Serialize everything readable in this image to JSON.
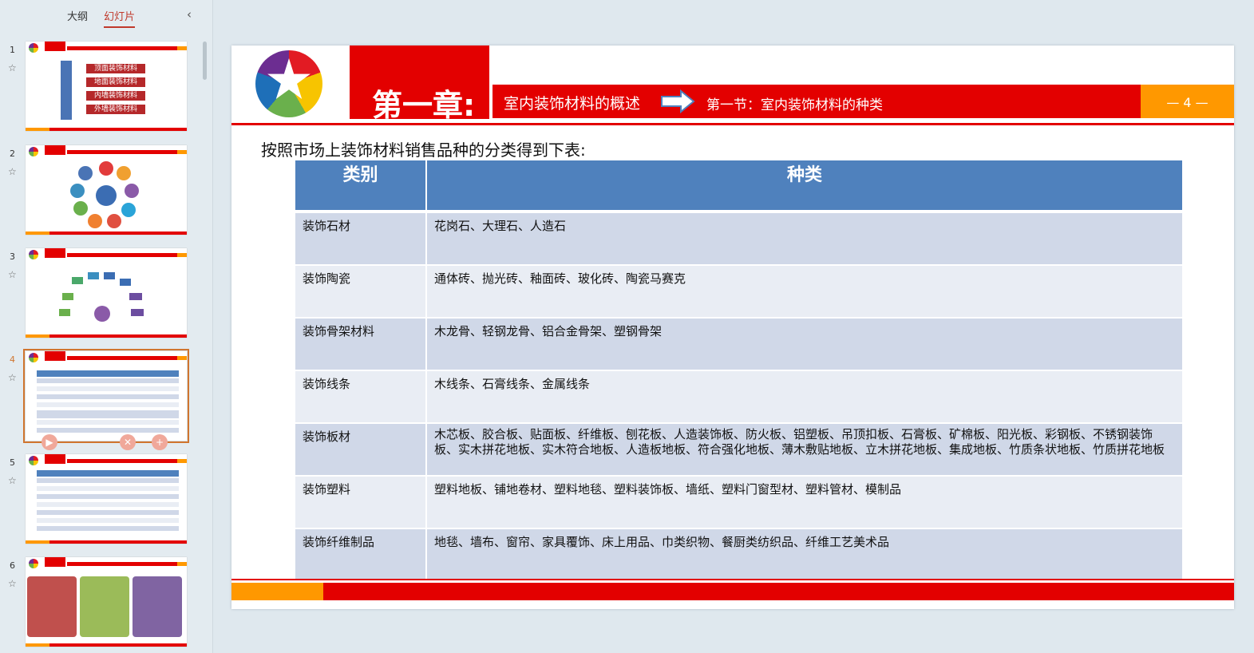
{
  "panel": {
    "tabs": [
      "大纲",
      "幻灯片"
    ],
    "active_tab": "幻灯片",
    "thumbnails": [
      {
        "number": "1",
        "boxes": [
          "顶面装饰材料",
          "地面装饰材料",
          "内墙装饰材料",
          "外墙装饰材料"
        ]
      },
      {
        "number": "2"
      },
      {
        "number": "3"
      },
      {
        "number": "4",
        "active": true
      },
      {
        "number": "5"
      },
      {
        "number": "6"
      }
    ]
  },
  "slide": {
    "chapter": "第一章:",
    "header_text": "室内装饰材料的概述",
    "section_text": "第一节：室内装饰材料的种类",
    "page_number": "— 4 —",
    "intro": "按照市场上装饰材料销售品种的分类得到下表:",
    "table": {
      "headers": [
        "类别",
        "种类"
      ],
      "rows": [
        {
          "category": "装饰石材",
          "types": "花岗石、大理石、人造石"
        },
        {
          "category": "装饰陶瓷",
          "types": "通体砖、抛光砖、釉面砖、玻化砖、陶瓷马赛克"
        },
        {
          "category": "装饰骨架材料",
          "types": "木龙骨、轻钢龙骨、铝合金骨架、塑钢骨架"
        },
        {
          "category": "装饰线条",
          "types": "木线条、石膏线条、金属线条"
        },
        {
          "category": "装饰板材",
          "types": "木芯板、胶合板、贴面板、纤维板、刨花板、人造装饰板、防火板、铝塑板、吊顶扣板、石膏板、矿棉板、阳光板、彩钢板、不锈钢装饰板、实木拼花地板、实木符合地板、人造板地板、符合强化地板、薄木敷贴地板、立木拼花地板、集成地板、竹质条状地板、竹质拼花地板"
        },
        {
          "category": "装饰塑料",
          "types": "塑料地板、铺地卷材、塑料地毯、塑料装饰板、墙纸、塑料门窗型材、塑料管材、模制品"
        },
        {
          "category": "装饰纤维制品",
          "types": "地毯、墙布、窗帘、家具覆饰、床上用品、巾类织物、餐厨类纺织品、纤维工艺美术品"
        }
      ]
    }
  },
  "colors": {
    "red": "#e30000",
    "orange": "#ff9800",
    "table_header": "#4f81bd",
    "row_dark": "#d0d8e8",
    "row_light": "#e9edf4"
  }
}
